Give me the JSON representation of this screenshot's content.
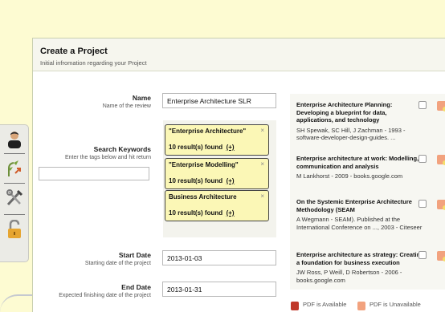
{
  "project": {
    "title": "Create a Project",
    "subtitle": "Initial infromation regarding your Project"
  },
  "name_field": {
    "label": "Name",
    "desc": "Name of the review",
    "value": "Enterprise Architecture SLR"
  },
  "keywords": {
    "label": "Search Keywords",
    "desc": "Enter the tags below and hit return",
    "tags": [
      {
        "text": "\"Enterprise Architecture\"",
        "count": "10 result(s) found",
        "plus": "(+)",
        "close": "×"
      },
      {
        "text": "\"Enterprise Modelling\"",
        "count": "10 result(s) found",
        "plus": "(+)",
        "close": "×"
      },
      {
        "text": "Business Architecture",
        "count": "10 result(s) found",
        "plus": "(+)",
        "close": "×"
      }
    ]
  },
  "start_date": {
    "label": "Start Date",
    "desc": "Starting date of the project",
    "value": "2013-01-03"
  },
  "end_date": {
    "label": "End Date",
    "desc": "Expected finishing date of the project",
    "value": "2013-01-31"
  },
  "results": [
    {
      "title": "Enterprise Architecture Planning: Developing a blueprint for data, applications, and technology",
      "meta": "SH Spewak, SC Hill, J Zachman - 1993 - software-developer-design-guides. ..."
    },
    {
      "title": "Enterprise architecture at work: Modelling, communication and analysis",
      "meta": "M Lankhorst - 2009 - books.google.com"
    },
    {
      "title": "On the Systemic Enterprise Architecture Methodology (SEAM",
      "meta": "A Wegmann - SEAM). Published at the International Conference on ..., 2003 - Citeseer"
    },
    {
      "title": "Enterprise architecture as strategy: Creating a foundation for business execution",
      "meta": "JW Ross, P Weill, D Robertson - 2006 - books.google.com"
    }
  ],
  "legend": {
    "available": "PDF is Available",
    "unavailable": "PDF is Unavailable"
  },
  "icons": [
    "user-icon",
    "plant-icon",
    "tools-icon",
    "unlock-icon"
  ],
  "colors": {
    "page_bg": "#fdfbd2",
    "tag_bg": "#fbf7b6",
    "pdf_available": "#c0392b",
    "pdf_unavailable": "#f2a27e"
  }
}
